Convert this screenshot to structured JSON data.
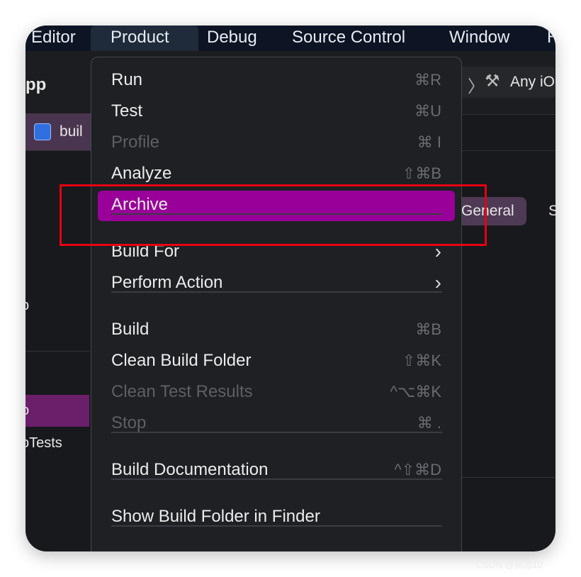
{
  "menubar": {
    "items": [
      "Editor",
      "Product",
      "Debug",
      "Source Control",
      "Window",
      "H"
    ],
    "active": "Product"
  },
  "toolbar": {
    "project_fragment": "pp",
    "scheme_fragment": "Any iO",
    "tab_fragment": "buil"
  },
  "editor": {
    "tab_general": "General",
    "tab_next": "S"
  },
  "sidebar": {
    "items": [
      "o",
      "o",
      "oTests"
    ]
  },
  "menu": {
    "items": [
      {
        "label": "Run",
        "shortcut": "⌘R",
        "enabled": true
      },
      {
        "label": "Test",
        "shortcut": "⌘U",
        "enabled": true
      },
      {
        "label": "Profile",
        "shortcut": "⌘ I",
        "enabled": false
      },
      {
        "label": "Analyze",
        "shortcut": "⇧⌘B",
        "enabled": true
      },
      {
        "label": "Archive",
        "shortcut": "",
        "enabled": true,
        "highlighted": true
      },
      {
        "label": "Build For",
        "shortcut": "›",
        "enabled": true
      },
      {
        "label": "Perform Action",
        "shortcut": "›",
        "enabled": true
      },
      {
        "label": "Build",
        "shortcut": "⌘B",
        "enabled": true
      },
      {
        "label": "Clean Build Folder",
        "shortcut": "⇧⌘K",
        "enabled": true
      },
      {
        "label": "Clean Test Results",
        "shortcut": "^⌥⌘K",
        "enabled": false
      },
      {
        "label": "Stop",
        "shortcut": "⌘ .",
        "enabled": false
      },
      {
        "label": "Build Documentation",
        "shortcut": "^⇧⌘D",
        "enabled": true
      },
      {
        "label": "Show Build Folder in Finder",
        "shortcut": "",
        "enabled": true
      }
    ]
  },
  "colors": {
    "highlight": "#990099",
    "annotation": "#e60012",
    "selection": "#6b1f6b"
  },
  "watermark": "CSDN @执念10"
}
